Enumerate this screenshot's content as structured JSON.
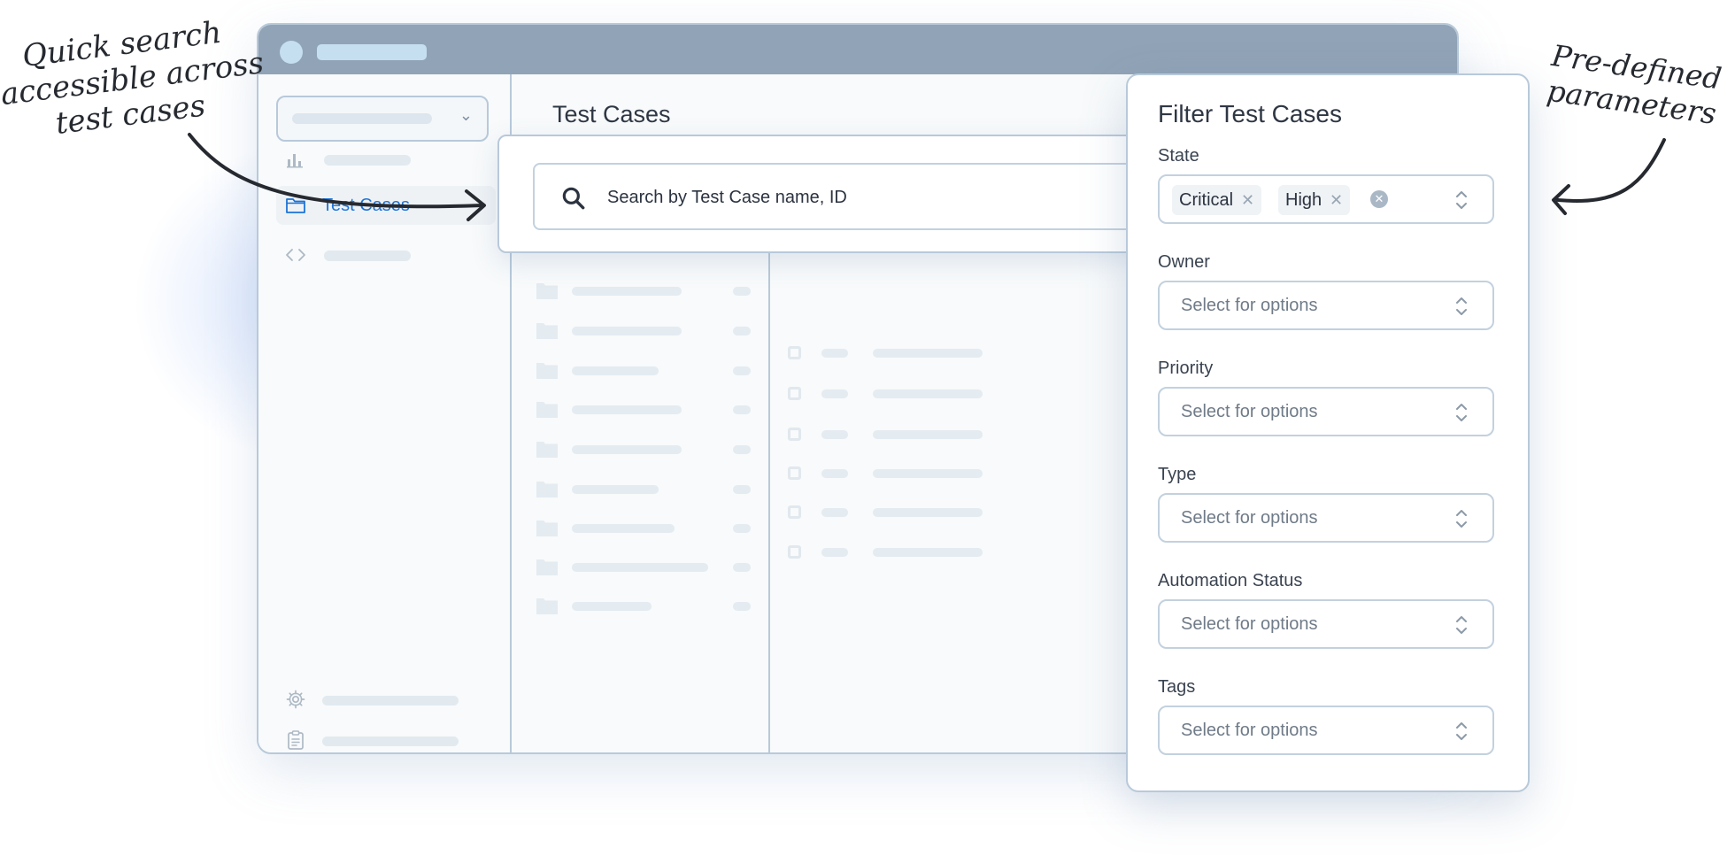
{
  "sidebar": {
    "active_item": {
      "label": "Test Cases",
      "icon": "folder-icon"
    },
    "icons": [
      "bar-chart-icon",
      "folder-icon",
      "code-icon",
      "gear-icon",
      "clipboard-icon"
    ]
  },
  "main": {
    "title": "Test Cases"
  },
  "search": {
    "placeholder": "Search by Test Case name, ID",
    "icon": "search-icon"
  },
  "filter": {
    "title": "Filter Test Cases",
    "state": {
      "label": "State",
      "chips": [
        "Critical",
        "High"
      ]
    },
    "owner": {
      "label": "Owner",
      "placeholder": "Select for options"
    },
    "priority": {
      "label": "Priority",
      "placeholder": "Select for options"
    },
    "type": {
      "label": "Type",
      "placeholder": "Select for options"
    },
    "automation_status": {
      "label": "Automation Status",
      "placeholder": "Select for options"
    },
    "tags": {
      "label": "Tags",
      "placeholder": "Select for options"
    }
  },
  "annotations": {
    "left": [
      "Quick search",
      "accessible across",
      "test cases"
    ],
    "right": [
      "Pre-defined",
      "parameters"
    ]
  },
  "colors": {
    "accent": "#1d73d6",
    "titlebar": "#91a3b6",
    "border": "#b8c9da",
    "placeholder_bar": "#e4ebf1"
  }
}
